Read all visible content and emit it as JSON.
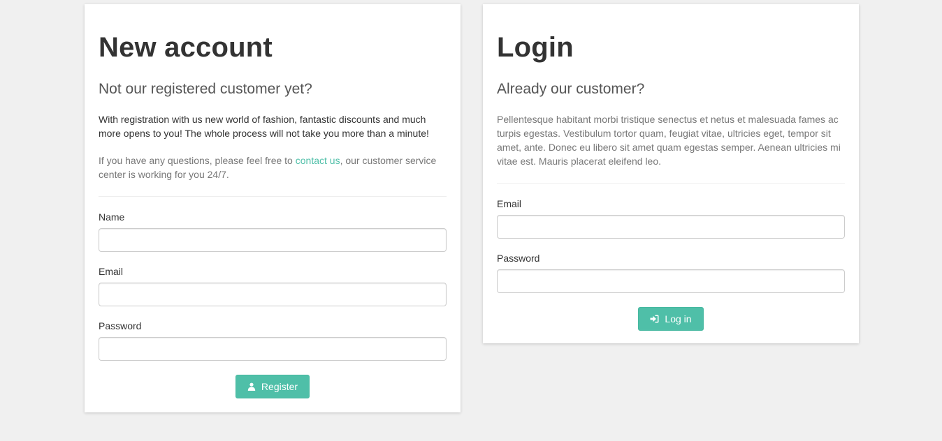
{
  "register": {
    "title": "New account",
    "lead": "Not our registered customer yet?",
    "intro": "With registration with us new world of fashion, fantastic discounts and much more opens to you! The whole process will not take you more than a minute!",
    "help_prefix": "If you have any questions, please feel free to ",
    "help_link": "contact us",
    "help_suffix": ", our customer service center is working for you 24/7.",
    "name_label": "Name",
    "name_value": "",
    "email_label": "Email",
    "email_value": "",
    "password_label": "Password",
    "password_value": "",
    "button_label": "Register",
    "button_icon": "user-icon"
  },
  "login": {
    "title": "Login",
    "lead": "Already our customer?",
    "intro": "Pellentesque habitant morbi tristique senectus et netus et malesuada fames ac turpis egestas. Vestibulum tortor quam, feugiat vitae, ultricies eget, tempor sit amet, ante. Donec eu libero sit amet quam egestas semper. Aenean ultricies mi vitae est. Mauris placerat eleifend leo.",
    "email_label": "Email",
    "email_value": "",
    "password_label": "Password",
    "password_value": "",
    "button_label": "Log in",
    "button_icon": "sign-in-icon"
  },
  "colors": {
    "accent": "#4fbfa8",
    "background": "#f0f0f0",
    "box": "#ffffff",
    "text": "#333333",
    "muted_text": "#777777"
  }
}
